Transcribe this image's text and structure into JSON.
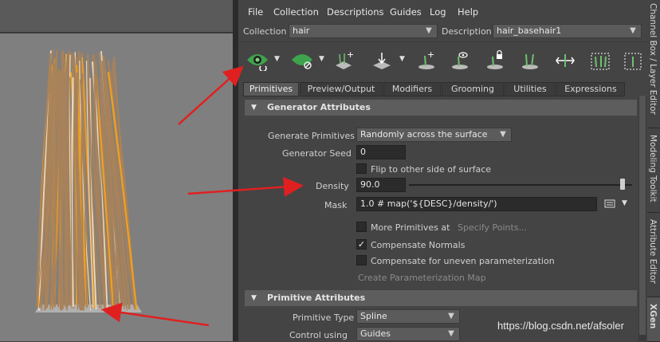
{
  "menubar": {
    "items": [
      "File",
      "Collection",
      "Descriptions",
      "Guides",
      "Log",
      "Help"
    ]
  },
  "collection": {
    "label": "Collection",
    "value": "hair"
  },
  "description": {
    "label": "Description",
    "value": "hair_basehair1"
  },
  "toolbar": {
    "icons": [
      "eye-refresh-icon",
      "preview-clear-icon",
      "add-primitives-icon",
      "move-primitives-icon",
      "add-guide-icon",
      "view-guide-icon",
      "lock-guide-icon",
      "guide-direction-icon",
      "flip-guide-icon",
      "select-guides-icon",
      "more-tools-icon"
    ]
  },
  "tabs": [
    "Primitives",
    "Preview/Output",
    "Modifiers",
    "Grooming",
    "Utilities",
    "Expressions"
  ],
  "generator": {
    "header": "Generator Attributes",
    "generate_label": "Generate Primitives",
    "generate_value": "Randomly across the surface",
    "seed_label": "Generator Seed",
    "seed_value": "0",
    "flip_label": "Flip to other side of surface",
    "density_label": "Density",
    "density_value": "90.0",
    "density_slider_fraction": 0.98,
    "mask_label": "Mask",
    "mask_value": "1.0 # map('${DESC}/density/')",
    "more_prims_label": "More Primitives at",
    "specify_points": "Specify Points...",
    "comp_normals_label": "Compensate Normals",
    "comp_normals_checked": true,
    "comp_param_label": "Compensate for uneven parameterization",
    "create_param_map": "Create Parameterization Map"
  },
  "primitive": {
    "header": "Primitive Attributes",
    "type_label": "Primitive Type",
    "type_value": "Spline",
    "control_label": "Control using",
    "control_value": "Guides"
  },
  "side_tabs": [
    "Channel Box / Layer Editor",
    "Modeling Toolkit",
    "Attribute Editor",
    "XGen"
  ],
  "watermark": "https://blog.csdn.net/afsoler",
  "colors": {
    "accent_green": "#4caf50",
    "arrow_red": "#e02020",
    "hair_brown": "#a8825a",
    "hair_orange": "#f0a020"
  }
}
